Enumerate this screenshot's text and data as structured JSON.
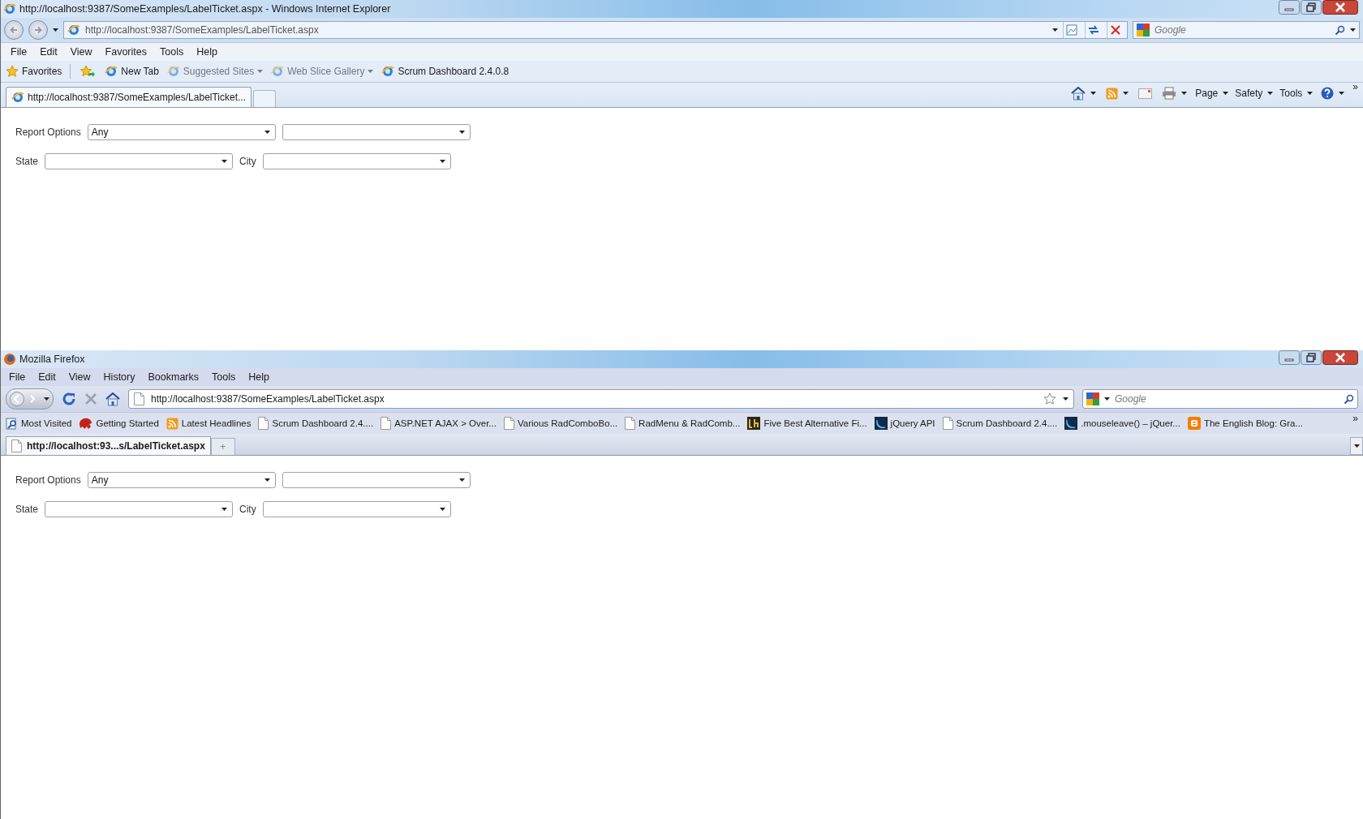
{
  "ie": {
    "title": "http://localhost:9387/SomeExamples/LabelTicket.aspx - Windows Internet Explorer",
    "address": "http://localhost:9387/SomeExamples/LabelTicket.aspx",
    "search_placeholder": "Google",
    "menu": [
      "File",
      "Edit",
      "View",
      "Favorites",
      "Tools",
      "Help"
    ],
    "favorites": [
      {
        "kind": "star",
        "label": "Favorites",
        "dimmed": false,
        "dropdown": false
      },
      {
        "kind": "star-add",
        "dimmed": false,
        "dropdown": false
      },
      {
        "kind": "ie",
        "label": "New Tab",
        "dimmed": false,
        "dropdown": false
      },
      {
        "kind": "ie",
        "label": "Suggested Sites",
        "dimmed": true,
        "dropdown": true
      },
      {
        "kind": "ie",
        "label": "Web Slice Gallery",
        "dimmed": true,
        "dropdown": true
      },
      {
        "kind": "ie",
        "label": "Scrum Dashboard 2.4.0.8",
        "dimmed": false,
        "dropdown": false
      }
    ],
    "tabs": [
      {
        "label": "http://localhost:9387/SomeExamples/LabelTicket...",
        "selected": true
      }
    ],
    "command_bar": [
      {
        "kind": "home",
        "dropdown": true
      },
      {
        "kind": "feed",
        "dropdown": true
      },
      {
        "kind": "mail",
        "dropdown": false
      },
      {
        "kind": "print",
        "dropdown": true
      },
      {
        "kind": "menu",
        "label": "Page",
        "dropdown": true
      },
      {
        "kind": "menu",
        "label": "Safety",
        "dropdown": true
      },
      {
        "kind": "menu",
        "label": "Tools",
        "dropdown": true
      },
      {
        "kind": "help",
        "dropdown": true
      }
    ],
    "overflow": "»",
    "form": [
      {
        "label": "Report Options",
        "selects": [
          {
            "kind": "select",
            "value": "Any"
          },
          {
            "kind": "select"
          }
        ]
      },
      {
        "label": "State",
        "selects": [
          {
            "kind": "select"
          }
        ],
        "label_2": "City",
        "selects_2": [
          {
            "kind": "select"
          }
        ]
      }
    ]
  },
  "firefox": {
    "title": "Mozilla Firefox",
    "menu": [
      "File",
      "Edit",
      "View",
      "History",
      "Bookmarks",
      "Tools",
      "Help"
    ],
    "address": "http://localhost:9387/SomeExamples/LabelTicket.aspx",
    "search_placeholder": "Google",
    "bookmarks": [
      {
        "kind": "search",
        "label": "Most Visited"
      },
      {
        "kind": "animal",
        "label": "Getting Started"
      },
      {
        "kind": "feed",
        "label": "Latest Headlines"
      },
      {
        "kind": "page",
        "label": "Scrum Dashboard 2.4...."
      },
      {
        "kind": "page",
        "label": "ASP.NET AJAX > Over..."
      },
      {
        "kind": "page",
        "label": "Various RadComboBo..."
      },
      {
        "kind": "page",
        "label": "RadMenu & RadComb..."
      },
      {
        "kind": "square",
        "label": "Five Best Alternative Fi..."
      },
      {
        "kind": "swirl",
        "label": "jQuery API"
      },
      {
        "kind": "page",
        "label": "Scrum Dashboard 2.4...."
      },
      {
        "kind": "swirl",
        "label": ".mouseleave() – jQuer..."
      },
      {
        "kind": "blog",
        "label": "The English Blog: Gra..."
      }
    ],
    "overflow": "»",
    "tabs": [
      {
        "label": "http://localhost:93...s/LabelTicket.aspx",
        "selected": true
      }
    ],
    "new_tab": "+",
    "form": [
      {
        "label": "Report Options",
        "selects": [
          {
            "kind": "select",
            "value": "Any"
          },
          {
            "kind": "select"
          }
        ]
      },
      {
        "label": "State",
        "selects": [
          {
            "kind": "select"
          }
        ],
        "label_2": "City",
        "selects_2": [
          {
            "kind": "select"
          }
        ]
      }
    ]
  }
}
